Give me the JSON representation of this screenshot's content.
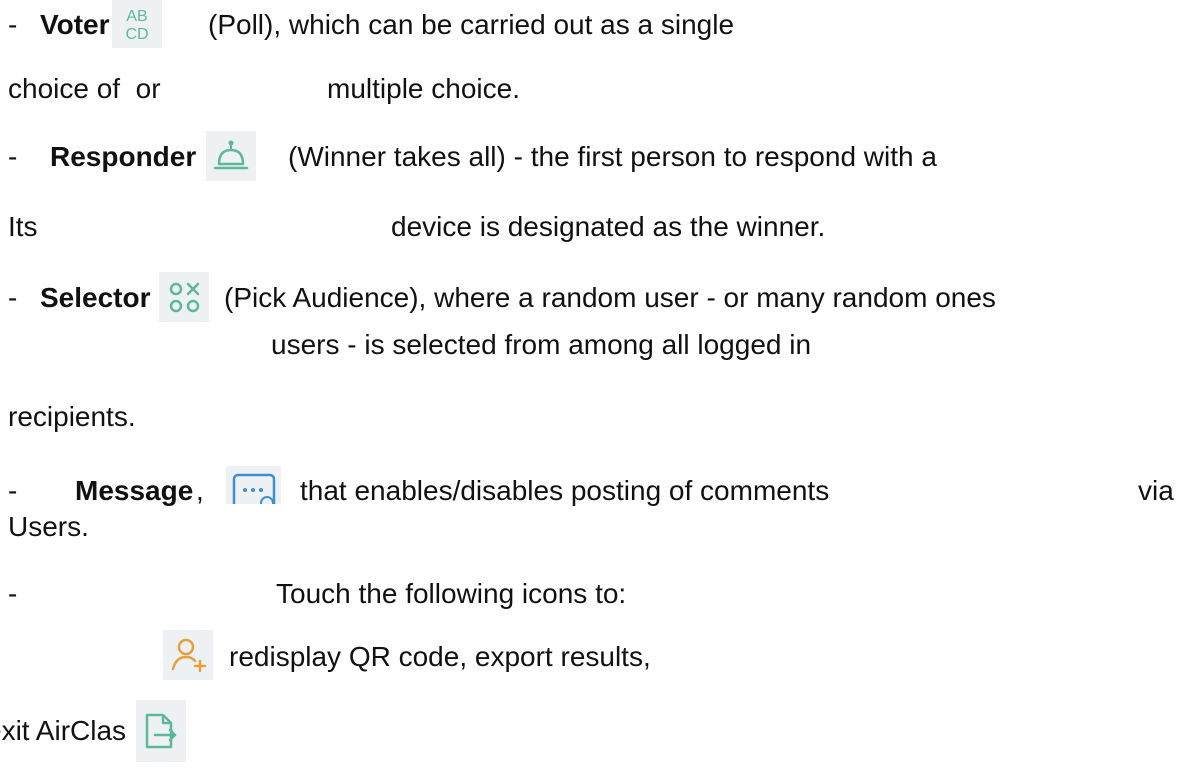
{
  "colors": {
    "icon_green": "#5db89a",
    "icon_orange": "#e59f3c",
    "icon_bg": "#eef1f3",
    "text": "#111111"
  },
  "lines": {
    "voter_dash": "- ",
    "voter_label": "Voter",
    "voter_rest": "(Poll), which can be carried out as a single",
    "choice_a": "choice of  or",
    "choice_b": "multiple choice.",
    "responder_dash": "-  ",
    "responder_label": "Responder",
    "responder_rest": "(Winner takes all) - the first person to respond with a",
    "its_a": "Its",
    "its_b": "device is designated as the winner.",
    "selector_dash": "- ",
    "selector_label": "Selector",
    "selector_rest": "(Pick Audience), where a random user - or many random ones",
    "selector_cont": "users - is selected from among all logged in",
    "recipients": "recipients.",
    "message_dash": "-",
    "message_label": "Message",
    "message_comma": ",",
    "message_rest": "that enables/disables posting of comments",
    "message_via": "via",
    "users": "Users.",
    "touch_dash": "-",
    "touch_text": "Touch the following icons to:",
    "redisplay": "redisplay QR code, export results,",
    "exit": "exit AirClas"
  },
  "icons": {
    "voter": "abcd-poll-icon",
    "responder": "bell-responder-icon",
    "selector": "circles-x-selector-icon",
    "message": "message-icon",
    "add_user": "add-user-icon",
    "exit": "exit-document-icon"
  },
  "icon_glyphs": {
    "voter_top": "AB",
    "voter_bottom": "CD"
  }
}
